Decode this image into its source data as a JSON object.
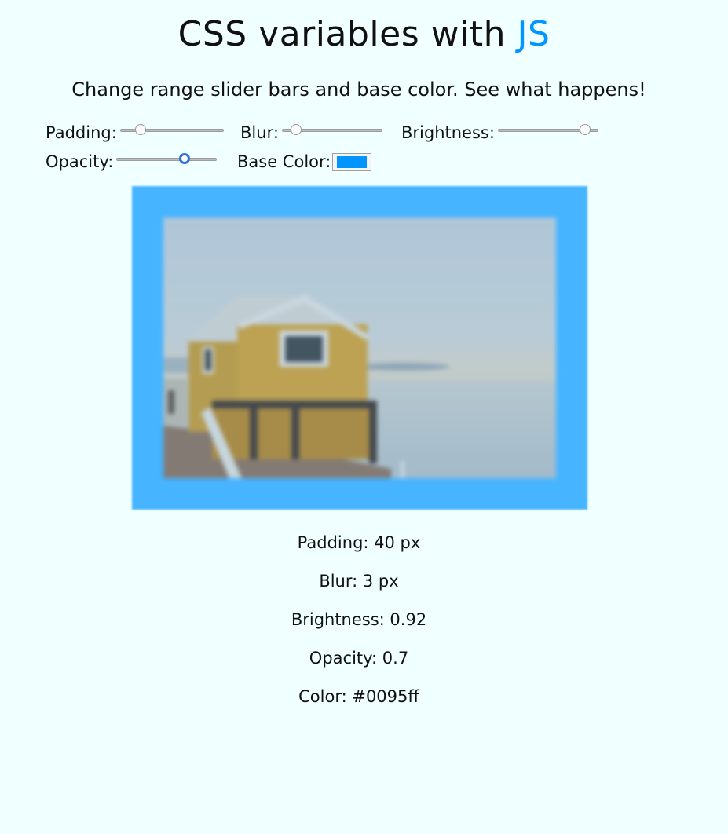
{
  "title": {
    "main": "CSS variables with",
    "accent": "JS"
  },
  "subtitle": "Change range slider bars and base color. See what happens!",
  "controls": {
    "padding_label": "Padding:",
    "blur_label": "Blur:",
    "brightness_label": "Brightness:",
    "opacity_label": "Opacity:",
    "base_color_label": "Base Color:"
  },
  "sliders": {
    "padding_fraction": 0.16,
    "blur_fraction": 0.09,
    "brightness_fraction": 0.92,
    "opacity_fraction": 0.7
  },
  "base_color": "#0095ff",
  "readouts": {
    "padding": "Padding: 40 px",
    "blur": "Blur: 3 px",
    "brightness": "Brightness: 0.92",
    "opacity": "Opacity: 0.7",
    "color": "Color: #0095ff"
  },
  "colors": {
    "background": "#f0ffff",
    "accent": "#0095ff"
  }
}
